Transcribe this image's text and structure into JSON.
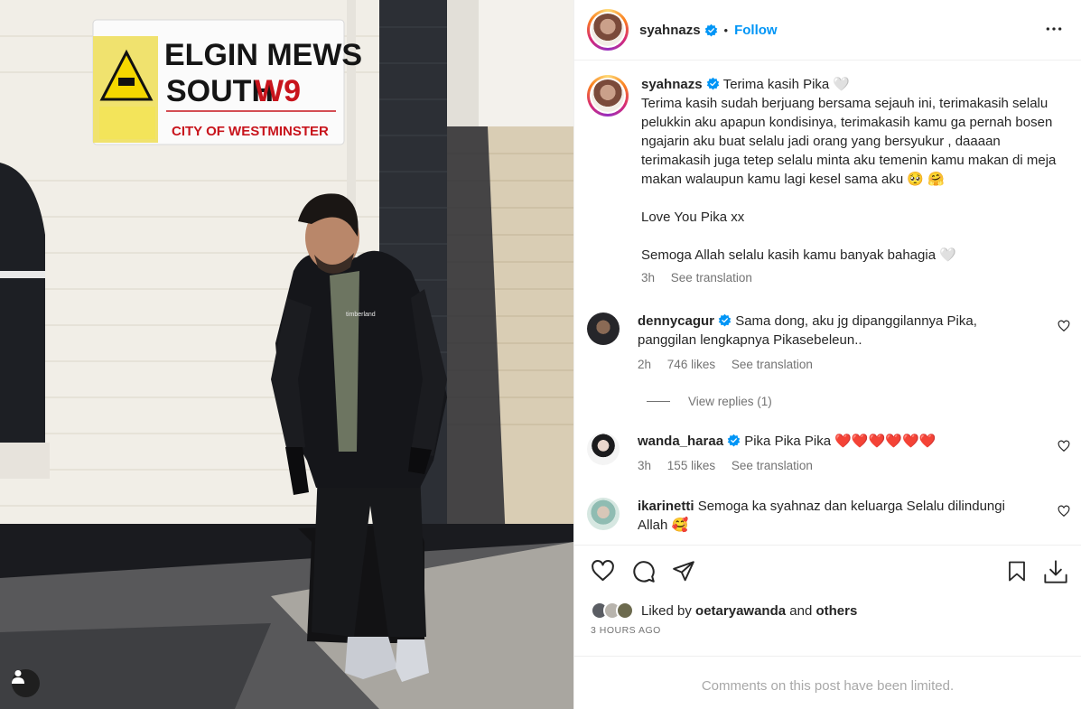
{
  "photo": {
    "sign": {
      "line1": "ELGIN MEWS",
      "line2": "SOUTH",
      "code": "W9",
      "council": "CITY OF WESTMINSTER",
      "jacket_brand": "timberland"
    },
    "tag_icon": "person-tag-icon"
  },
  "header": {
    "username": "syahnazs",
    "separator": "•",
    "follow_label": "Follow",
    "more_icon": "more-dots-icon"
  },
  "caption": {
    "username": "syahnazs",
    "text": "Terima kasih Pika 🤍\nTerima kasih sudah berjuang bersama sejauh ini, terimakasih selalu pelukkin aku apapun kondisinya, terimakasih kamu ga pernah bosen ngajarin aku buat selalu jadi orang yang bersyukur , daaaan terimakasih juga tetep selalu minta aku temenin kamu makan di meja makan walaupun kamu lagi kesel sama aku 🥺 🤗\n\nLove You Pika xx\n\nSemoga Allah selalu kasih kamu banyak bahagia 🤍",
    "time": "3h",
    "see_translation": "See translation"
  },
  "comments": [
    {
      "username": "dennycagur",
      "verified": true,
      "text": "Sama dong, aku jg dipanggilannya Pika, panggilan lengkapnya Pikasebeleun..",
      "time": "2h",
      "likes": "746 likes",
      "see_translation": "See translation",
      "replies": "View replies (1)"
    },
    {
      "username": "wanda_haraa",
      "verified": true,
      "text": "Pika Pika Pika ❤️❤️❤️❤️❤️❤️",
      "time": "3h",
      "likes": "155 likes",
      "see_translation": "See translation"
    },
    {
      "username": "ikarinetti",
      "verified": false,
      "text": "Semoga ka syahnaz dan keluarga Selalu dilindungi Allah 🥰"
    }
  ],
  "footer": {
    "liked_prefix": "Liked by",
    "liked_user": "oetaryawanda",
    "liked_and": "and",
    "liked_others": "others",
    "timestamp": "3 HOURS AGO",
    "limited": "Comments on this post have been limited."
  },
  "colors": {
    "accent": "#0095f6",
    "text": "#262626",
    "secondary": "#737373",
    "border": "#efefef",
    "heart_red": "#ed4956"
  }
}
